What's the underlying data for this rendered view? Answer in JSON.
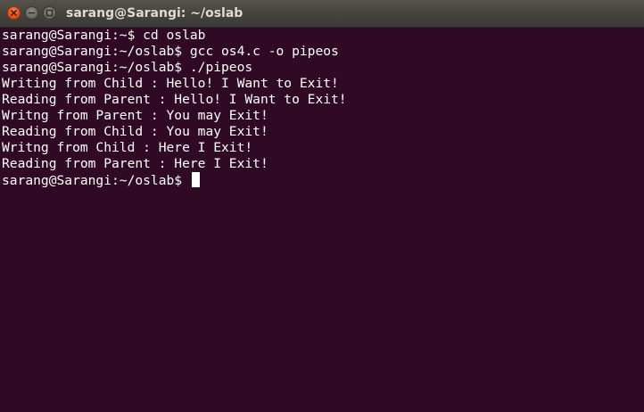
{
  "window": {
    "title": "sarang@Sarangi: ~/oslab"
  },
  "terminal": {
    "lines": [
      "sarang@Sarangi:~$ cd oslab",
      "sarang@Sarangi:~/oslab$ gcc os4.c -o pipeos",
      "sarang@Sarangi:~/oslab$ ./pipeos",
      "Writing from Child : Hello! I Want to Exit!",
      "Reading from Parent : Hello! I Want to Exit!",
      "Writng from Parent : You may Exit!",
      "Reading from Child : You may Exit!",
      "Writng from Child : Here I Exit!",
      "Reading from Parent : Here I Exit!"
    ],
    "prompt": "sarang@Sarangi:~/oslab$ "
  },
  "colors": {
    "terminal_background": "#300a24",
    "terminal_text": "#ffffff",
    "titlebar": "#45433d",
    "close_button": "#e9541f"
  }
}
